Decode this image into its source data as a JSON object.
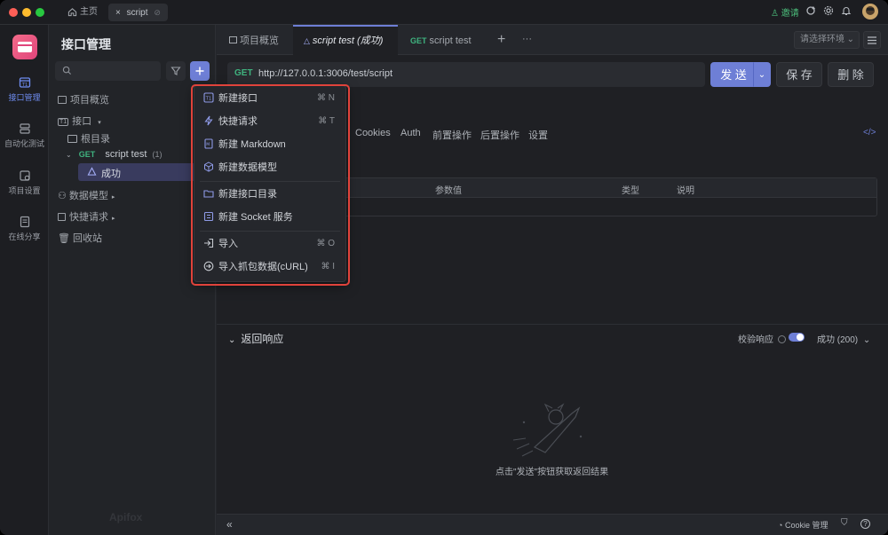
{
  "titlebar": {
    "home_tab": "主页",
    "script_tab": "script",
    "invite": "邀请"
  },
  "rail": {
    "items": [
      {
        "label": "接口管理"
      },
      {
        "label": "自动化测试"
      },
      {
        "label": "项目设置"
      },
      {
        "label": "在线分享"
      }
    ]
  },
  "sidebar": {
    "title": "接口管理",
    "search_placeholder": "",
    "overview": "项目概览",
    "api": "接口",
    "root": "根目录",
    "method": "GET",
    "script_test": "script test",
    "script_count": "(1)",
    "success": "成功",
    "data_model": "数据模型",
    "quick_request": "快捷请求",
    "recycle": "回收站",
    "watermark": "Apifox"
  },
  "tabs": [
    {
      "label": "项目概览"
    },
    {
      "label": "script test (成功)"
    },
    {
      "method": "GET",
      "label": "script test"
    }
  ],
  "env_select": "请选择环境",
  "request": {
    "method": "GET",
    "url": "http://127.0.0.1:3006/test/script",
    "send": "发 送",
    "save": "保 存",
    "delete": "删 除"
  },
  "subtabs": [
    "s",
    "Cookies",
    "Auth",
    "前置操作",
    "后置操作",
    "设置"
  ],
  "params_head": [
    "参数值",
    "类型",
    "说明"
  ],
  "response": {
    "title": "返回响应",
    "validate": "校验响应",
    "status": "成功 (200)",
    "empty": "点击\"发送\"按钮获取返回结果"
  },
  "footer": {
    "cookie": "Cookie 管理"
  },
  "menu": {
    "items": [
      {
        "label": "新建接口",
        "shortcut": "⌘ N",
        "icon": "api-icon"
      },
      {
        "label": "快捷请求",
        "shortcut": "⌘ T",
        "icon": "bolt-icon"
      },
      {
        "label": "新建 Markdown",
        "shortcut": "",
        "icon": "markdown-icon"
      },
      {
        "label": "新建数据模型",
        "shortcut": "",
        "icon": "cube-icon"
      },
      {
        "label": "新建接口目录",
        "shortcut": "",
        "icon": "folder-icon"
      },
      {
        "label": "新建 Socket 服务",
        "shortcut": "",
        "icon": "socket-icon"
      },
      {
        "label": "导入",
        "shortcut": "⌘ O",
        "icon": "import-icon"
      },
      {
        "label": "导入抓包数据(cURL)",
        "shortcut": "⌘ I",
        "icon": "import-curl-icon"
      }
    ]
  },
  "colors": {
    "accent": "#6e7fd6",
    "get_method": "#3fb37f",
    "highlight_border": "#e0433b"
  }
}
